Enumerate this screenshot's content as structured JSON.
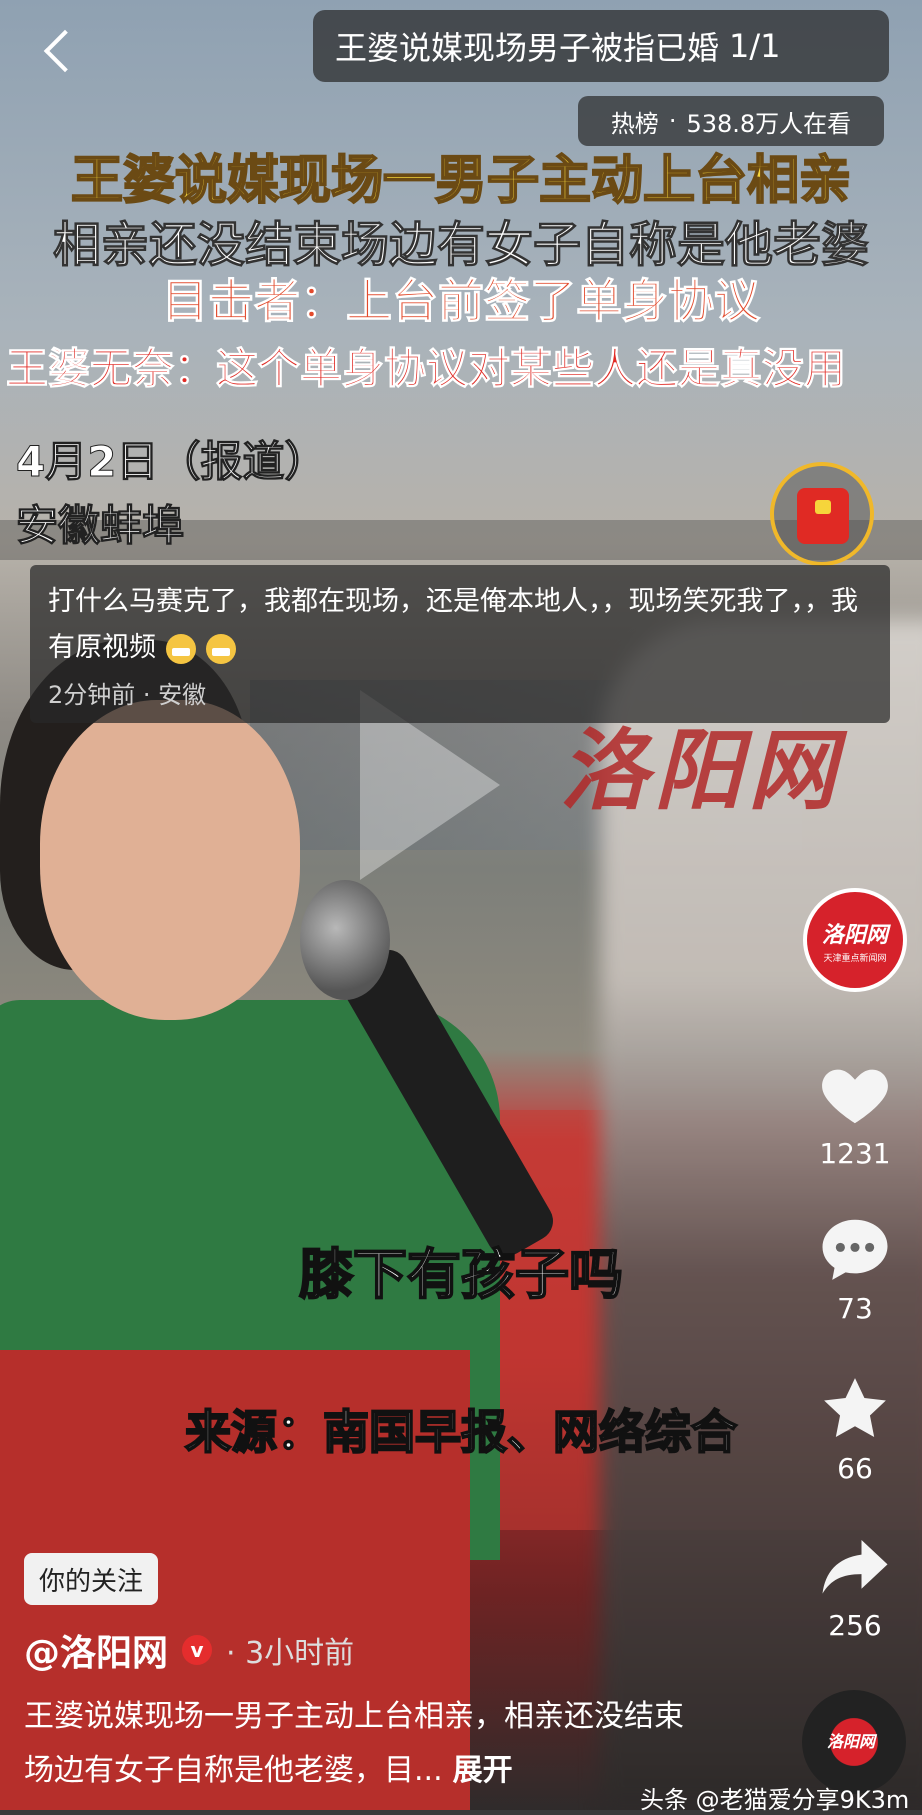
{
  "header": {
    "title": "王婆说媒现场男子被指已婚",
    "page_indicator": "1/1",
    "hot_label": "热榜",
    "hot_separator": "·",
    "hot_viewers": "538.8万人在看"
  },
  "video_text": {
    "headline_1": "王婆说媒现场一男子主动上台相亲",
    "headline_2": "相亲还没结束场边有女子自称是他老婆",
    "headline_3": "目击者：上台前签了单身协议",
    "headline_4": "王婆无奈：这个单身协议对某些人还是真没用",
    "date": "4月2日（报道）",
    "location": "安徽蚌埠",
    "watermark": "洛阳网",
    "subtitle_1": "膝下有孩子吗",
    "subtitle_2": "来源：南国早报、网络综合"
  },
  "comment": {
    "text": "打什么马赛克了，我都在现场，还是俺本地人，，现场笑死我了，，我有原视频",
    "meta": "2分钟前 · 安徽"
  },
  "sidebar": {
    "avatar_logo": "洛阳网",
    "avatar_slogan": "天津重点新闻网",
    "likes": "1231",
    "comments": "73",
    "favorites": "66",
    "shares": "256",
    "disc_label": "洛阳网"
  },
  "footer": {
    "follow_tag": "你的关注",
    "author": "@洛阳网",
    "verified_mark": "v",
    "time": "· 3小时前",
    "description": "王婆说媒现场一男子主动上台相亲，相亲还没结束场边有女子自称是他老婆，目...",
    "expand": "展开",
    "credit": "头条 @老猫爱分享9K3m"
  },
  "icons": [
    "back-icon",
    "red-packet-icon",
    "play-icon",
    "heart-icon",
    "comment-icon",
    "star-icon",
    "share-icon",
    "music-disc-icon"
  ],
  "colors": {
    "headline_yellow": "#f6d53b",
    "headline_red": "#e02a24",
    "brand_red": "#d6222b"
  }
}
